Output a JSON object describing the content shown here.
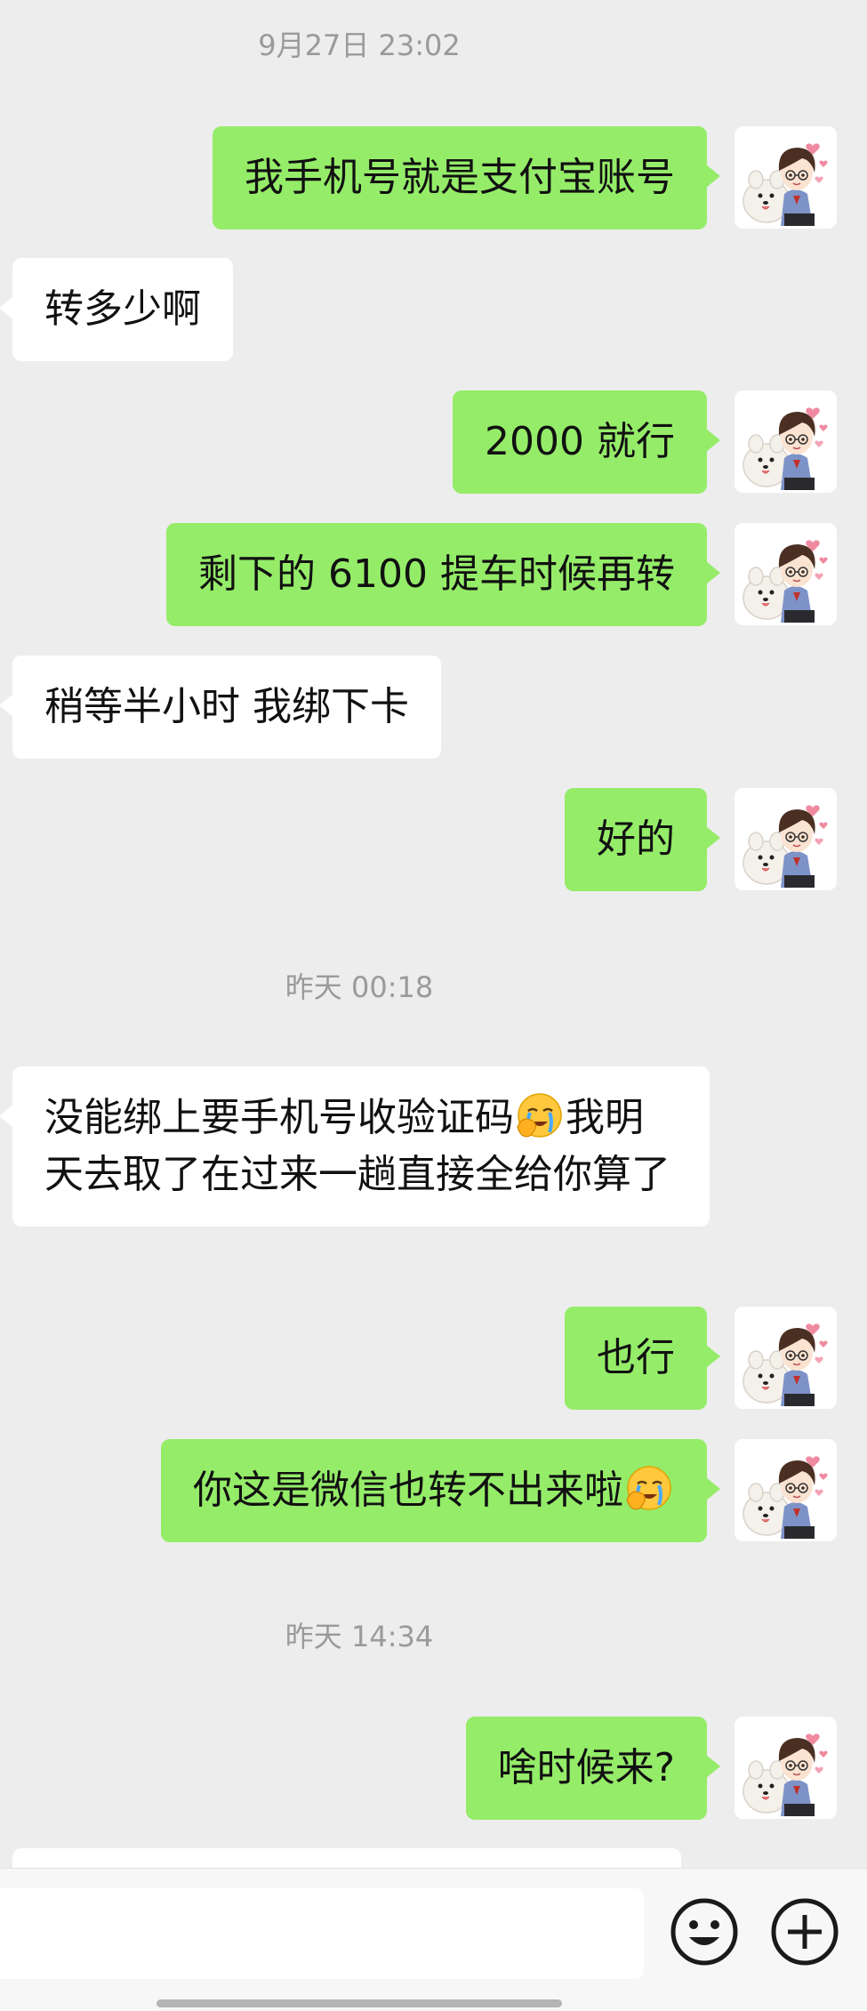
{
  "colors": {
    "background": "#ededed",
    "sent_bubble": "#95ec69",
    "received_bubble": "#ffffff",
    "timestamp": "#9a9a9a"
  },
  "messages": [
    {
      "type": "timestamp",
      "text": "9月27日 23:02"
    },
    {
      "type": "sent",
      "text": "我手机号就是支付宝账号",
      "avatar": "user-avatar-icon"
    },
    {
      "type": "received",
      "text": "转多少啊"
    },
    {
      "type": "sent",
      "text": "2000 就行",
      "avatar": "user-avatar-icon"
    },
    {
      "type": "sent",
      "text": "剩下的 6100 提车时候再转",
      "avatar": "user-avatar-icon"
    },
    {
      "type": "received",
      "text": "稍等半小时 我绑下卡"
    },
    {
      "type": "sent",
      "text": "好的",
      "avatar": "user-avatar-icon"
    },
    {
      "type": "timestamp",
      "text": "昨天 00:18"
    },
    {
      "type": "received",
      "text_before": "没能绑上要手机号收验证码",
      "emoji": "facepalm-emoji-icon",
      "text_after": "我明天去取了在过来一趟直接全给你算了"
    },
    {
      "type": "sent",
      "text": "也行",
      "avatar": "user-avatar-icon"
    },
    {
      "type": "sent",
      "text_before": "你这是微信也转不出来啦",
      "emoji": "facepalm-emoji-icon",
      "text_after": "",
      "avatar": "user-avatar-icon"
    },
    {
      "type": "timestamp",
      "text": "昨天 14:34"
    },
    {
      "type": "sent",
      "text": "啥时候来?",
      "avatar": "user-avatar-icon"
    },
    {
      "type": "received",
      "text": ""
    }
  ],
  "input_bar": {
    "value": "",
    "emoji_button_icon": "smiley-face-icon",
    "plus_button_icon": "plus-circle-icon"
  }
}
